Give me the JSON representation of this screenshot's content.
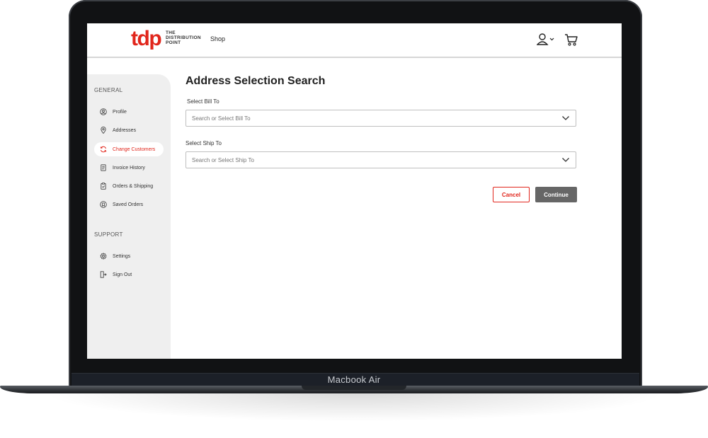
{
  "device": {
    "model_label": "Macbook Air"
  },
  "header": {
    "logo_mark": "tdp",
    "logo_text_line1": "THE",
    "logo_text_line2": "DISTRIBUTION",
    "logo_text_line3": "POINT",
    "nav_shop": "Shop",
    "icons": [
      "user-icon",
      "chevron-down-icon",
      "cart-icon"
    ]
  },
  "sidebar": {
    "general_title": "GENERAL",
    "support_title": "SUPPORT",
    "general_items": [
      {
        "label": "Profile",
        "icon": "user-circle-icon"
      },
      {
        "label": "Addresses",
        "icon": "location-pin-icon"
      },
      {
        "label": "Change Customers",
        "icon": "refresh-icon",
        "active": true
      },
      {
        "label": "Invoice History",
        "icon": "invoice-icon"
      },
      {
        "label": "Orders & Shipping",
        "icon": "clipboard-icon"
      },
      {
        "label": "Saved Orders",
        "icon": "saved-icon"
      }
    ],
    "support_items": [
      {
        "label": "Settings",
        "icon": "gear-icon"
      },
      {
        "label": "Sign Out",
        "icon": "sign-out-icon"
      }
    ]
  },
  "main": {
    "title": "Address Selection Search",
    "bill_to": {
      "label": "Select Bill To",
      "placeholder": "Search or Select Bill To"
    },
    "ship_to": {
      "label": "Select Ship To",
      "placeholder": "Search or Select Ship To"
    },
    "cancel_label": "Cancel",
    "continue_label": "Continue"
  },
  "colors": {
    "brand_red": "#e1261c",
    "continue_gray": "#666666",
    "sidebar_bg": "#efefef"
  }
}
